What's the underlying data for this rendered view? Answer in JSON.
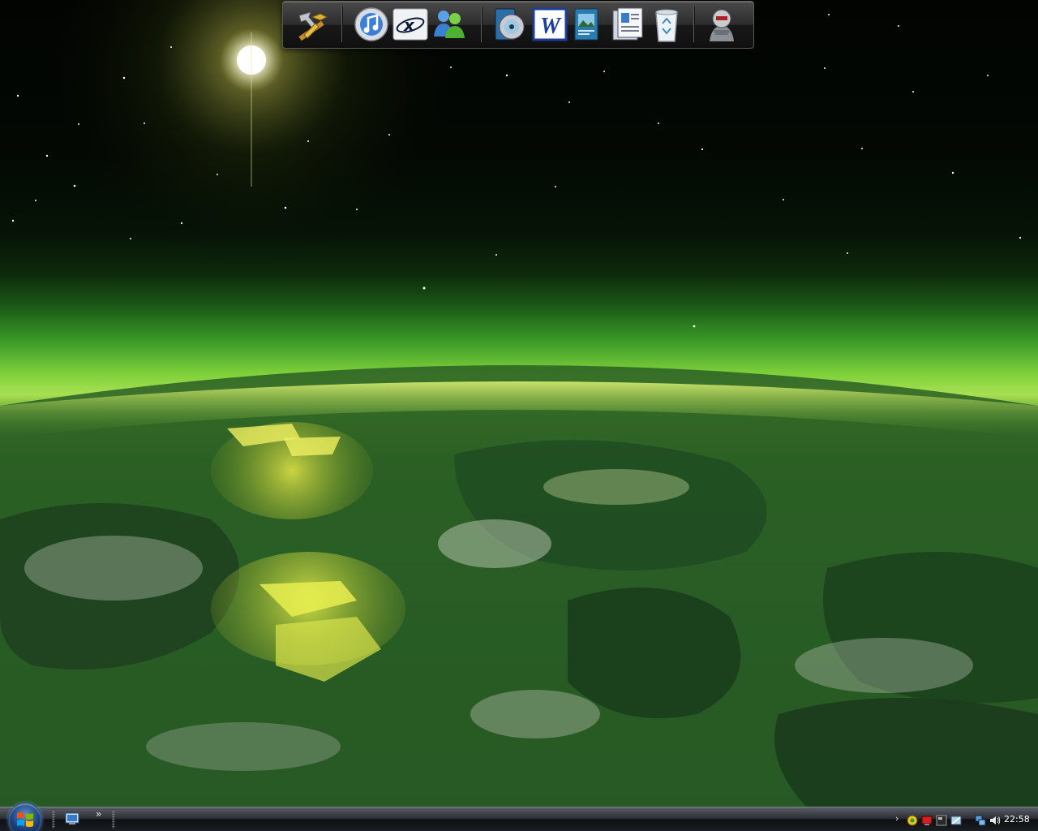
{
  "desktop": {
    "wallpaper": "green-planet-from-space",
    "colors": {
      "sky": "#020402",
      "atmosphere": "#a8e052",
      "land": "#2f6a22",
      "sun": "#ffffff"
    }
  },
  "dock": {
    "items": [
      {
        "name": "tools-icon"
      },
      {
        "name": "itunes-icon"
      },
      {
        "name": "xfire-icon"
      },
      {
        "name": "messenger-icon"
      },
      {
        "name": "media-player-icon"
      },
      {
        "name": "word-icon",
        "glyph": "W"
      },
      {
        "name": "picture-viewer-icon"
      },
      {
        "name": "documents-icon"
      },
      {
        "name": "recycle-bin-icon"
      },
      {
        "name": "robot-avatar-icon"
      }
    ]
  },
  "taskbar": {
    "quick_launch": [
      {
        "name": "show-desktop-icon"
      }
    ],
    "chevron": "»",
    "tray": {
      "expand": "›",
      "icons": [
        "network-status-icon",
        "antivirus-icon",
        "monitor-icon",
        "display-icon",
        "network-icon",
        "volume-icon"
      ],
      "clock": "22:58"
    }
  }
}
